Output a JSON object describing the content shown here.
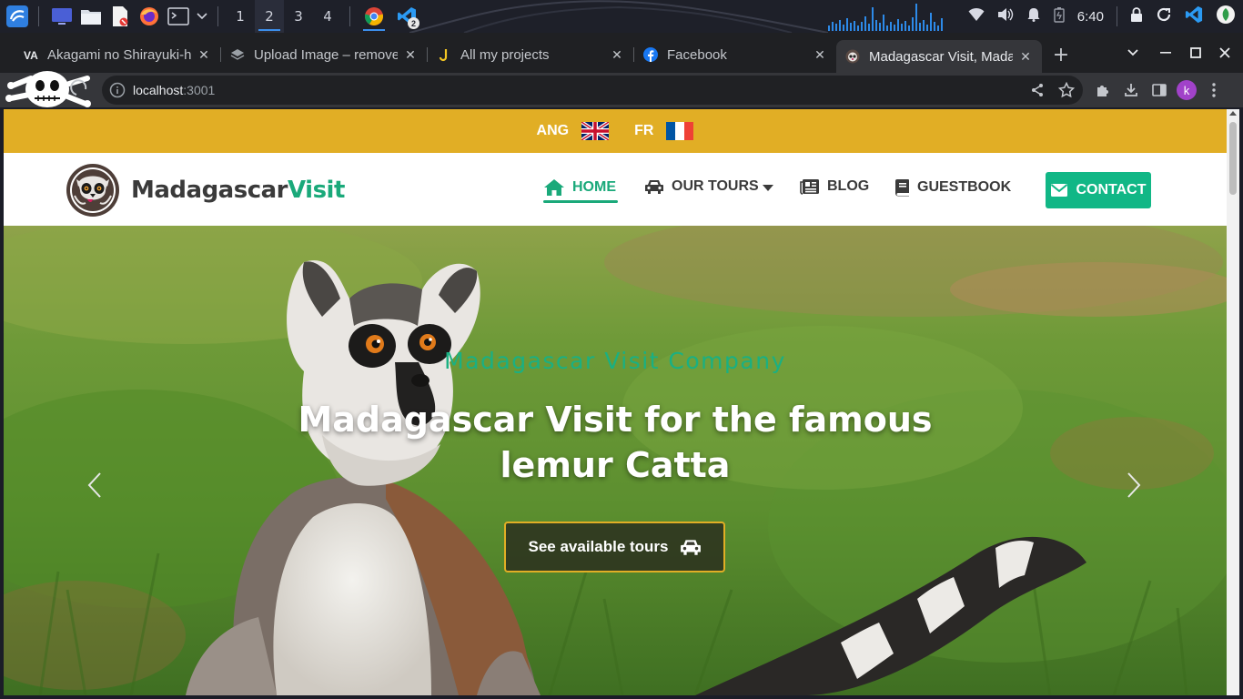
{
  "taskbar": {
    "workspaces": [
      "1",
      "2",
      "3",
      "4"
    ],
    "active_workspace": "2",
    "vscode_badge": "2",
    "clock": "6:40",
    "accent": "#3b8eea"
  },
  "browser": {
    "tabs": [
      {
        "title": "Akagami no Shirayuki-h",
        "icon": "va-logo-icon"
      },
      {
        "title": "Upload Image – remove",
        "icon": "layers-icon"
      },
      {
        "title": "All my projects",
        "icon": "j-logo-icon"
      },
      {
        "title": "Facebook",
        "icon": "facebook-icon"
      },
      {
        "title": "Madagascar Visit, Mada",
        "icon": "lemur-favicon-icon"
      }
    ],
    "active_tab": 4,
    "url_host": "localhost",
    "url_port": ":3001",
    "profile_initial": "k",
    "profile_color": "#a142c9"
  },
  "site": {
    "languages": [
      {
        "label": "ANG",
        "flag": "uk-flag-icon"
      },
      {
        "label": "FR",
        "flag": "fr-flag-icon"
      }
    ],
    "lang_bar_color": "#e1ae25",
    "brand": {
      "part1": "Madagascar",
      "part2": "Visit",
      "accent": "#1aa97a"
    },
    "nav": [
      {
        "label": "HOME",
        "icon": "home-icon",
        "active": true
      },
      {
        "label": "OUR TOURS",
        "icon": "car-icon",
        "dropdown": true
      },
      {
        "label": "BLOG",
        "icon": "newspaper-icon"
      },
      {
        "label": "GUESTBOOK",
        "icon": "book-icon"
      }
    ],
    "contact": {
      "label": "CONTACT",
      "icon": "envelope-icon",
      "color": "#11b786"
    },
    "hero": {
      "subtitle": "Madagascar Visit Company",
      "title_line1": "Madagascar Visit for the famous",
      "title_line2": "lemur Catta",
      "button": "See available tours",
      "button_icon": "car-icon"
    }
  }
}
